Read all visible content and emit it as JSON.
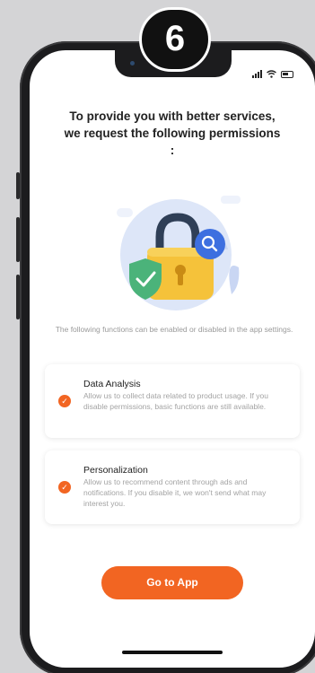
{
  "step_badge": "6",
  "header": {
    "title_line1": "To provide you with better services,",
    "title_line2": "we request the following permissions",
    "title_line3": ":"
  },
  "description": "The following functions can be enabled or disabled in the app settings.",
  "permissions": [
    {
      "title": "Data Analysis",
      "text": "Allow us to collect data related to product usage. If you disable permissions, basic functions are still available.",
      "checked": true
    },
    {
      "title": "Personalization",
      "text": "Allow us to recommend content through ads and notifications. If you disable it, we won't send what may interest you.",
      "checked": true
    }
  ],
  "cta_label": "Go to App",
  "colors": {
    "accent": "#f26522",
    "lock_body": "#f5c23a",
    "shield": "#4bb37a",
    "search_badge": "#3d6fe0"
  },
  "icons": [
    "check-icon",
    "lock-icon",
    "shield-check-icon",
    "search-icon",
    "wifi-icon",
    "battery-icon",
    "signal-icon"
  ]
}
